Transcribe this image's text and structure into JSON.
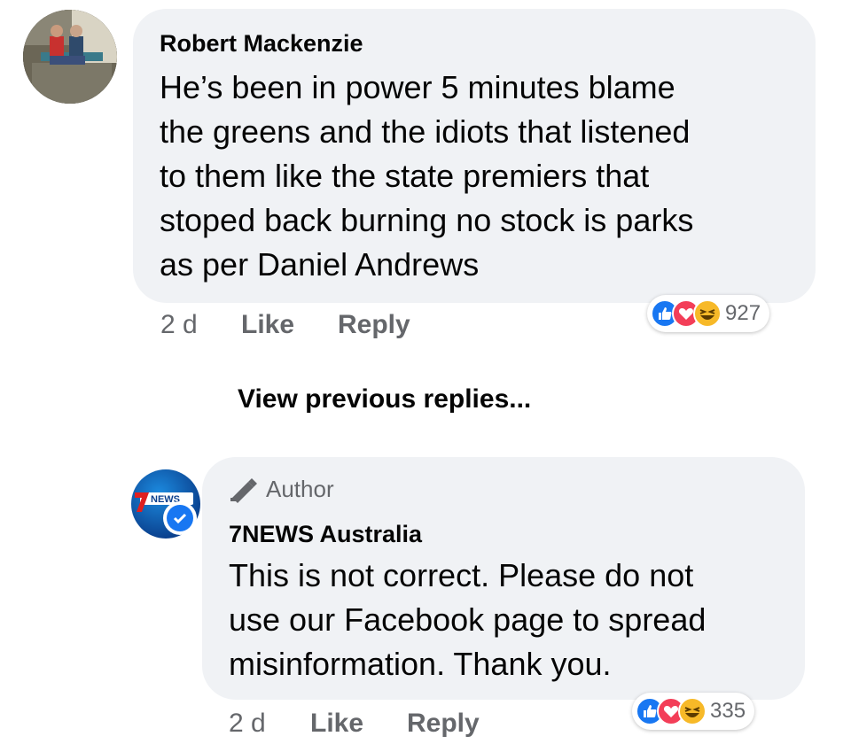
{
  "comment": {
    "author": "Robert Mackenzie",
    "text_lines": [
      "He’s been in power 5 minutes blame",
      "the greens and the idiots that listened",
      "to them like the state premiers that",
      "stoped back burning no stock is parks",
      "as per Daniel Andrews"
    ],
    "time": "2 d",
    "like_label": "Like",
    "reply_label": "Reply",
    "reaction_count": "927",
    "reactions": [
      "like-icon",
      "love-icon",
      "haha-icon"
    ]
  },
  "view_previous": "View previous replies...",
  "reply": {
    "badge_label": "Author",
    "author": "7NEWS Australia",
    "avatar_text": "NEWS",
    "text_lines": [
      "This is not correct. Please do not",
      "use our Facebook page to spread",
      "misinformation. Thank you."
    ],
    "time": "2 d",
    "like_label": "Like",
    "reply_label": "Reply",
    "reaction_count": "335",
    "reactions": [
      "like-icon",
      "love-icon",
      "haha-icon"
    ]
  },
  "colors": {
    "bubble": "#f0f2f5",
    "secondary_text": "#65676b",
    "like_blue": "#1877f2",
    "love_red": "#f33e58",
    "haha_yellow": "#f7b928"
  }
}
